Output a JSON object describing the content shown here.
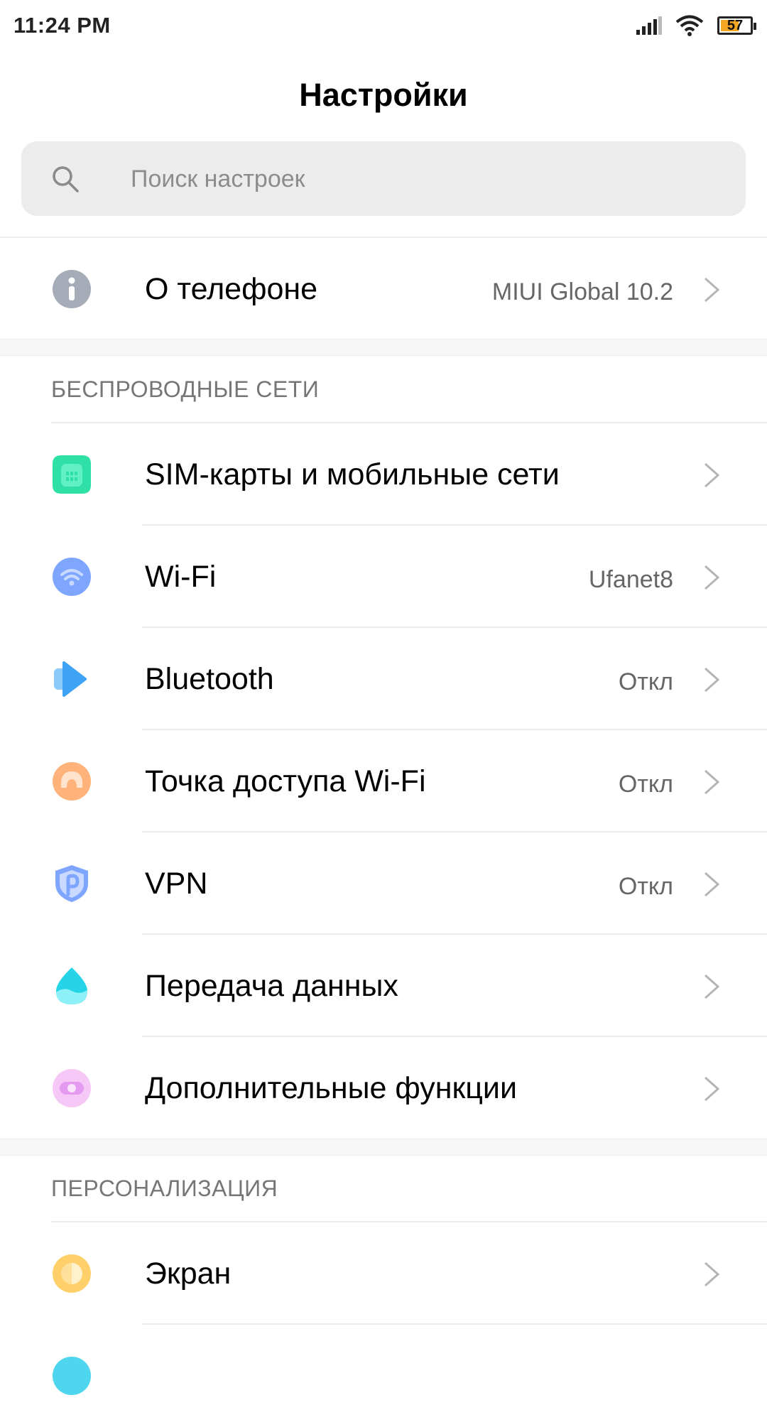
{
  "status_bar": {
    "time": "11:24 PM",
    "battery_level": "57"
  },
  "header": {
    "title": "Настройки"
  },
  "search": {
    "placeholder": "Поиск настроек"
  },
  "about": {
    "label": "О телефоне",
    "value": "MIUI Global 10.2",
    "icon": "info-icon"
  },
  "wireless": {
    "header": "БЕСПРОВОДНЫЕ СЕТИ",
    "items": [
      {
        "label": "SIM-карты и мобильные сети",
        "value": "",
        "icon": "sim-card-icon",
        "color": "#2fe0a6"
      },
      {
        "label": "Wi-Fi",
        "value": "Ufanet8",
        "icon": "wifi-icon",
        "color": "#7ea6ff"
      },
      {
        "label": "Bluetooth",
        "value": "Откл",
        "icon": "bluetooth-icon",
        "color": "#3fa3f5"
      },
      {
        "label": "Точка доступа Wi-Fi",
        "value": "Откл",
        "icon": "hotspot-icon",
        "color": "#ffb27a"
      },
      {
        "label": "VPN",
        "value": "Откл",
        "icon": "vpn-icon",
        "color": "#7ea6ff"
      },
      {
        "label": "Передача данных",
        "value": "",
        "icon": "data-usage-icon",
        "color": "#26d4e8"
      },
      {
        "label": "Дополнительные функции",
        "value": "",
        "icon": "more-functions-icon",
        "color": "#f4b3f7"
      }
    ]
  },
  "personalization": {
    "header": "ПЕРСОНАЛИЗАЦИЯ",
    "items": [
      {
        "label": "Экран",
        "value": "",
        "icon": "display-icon",
        "color": "#ffcf6a"
      }
    ]
  }
}
